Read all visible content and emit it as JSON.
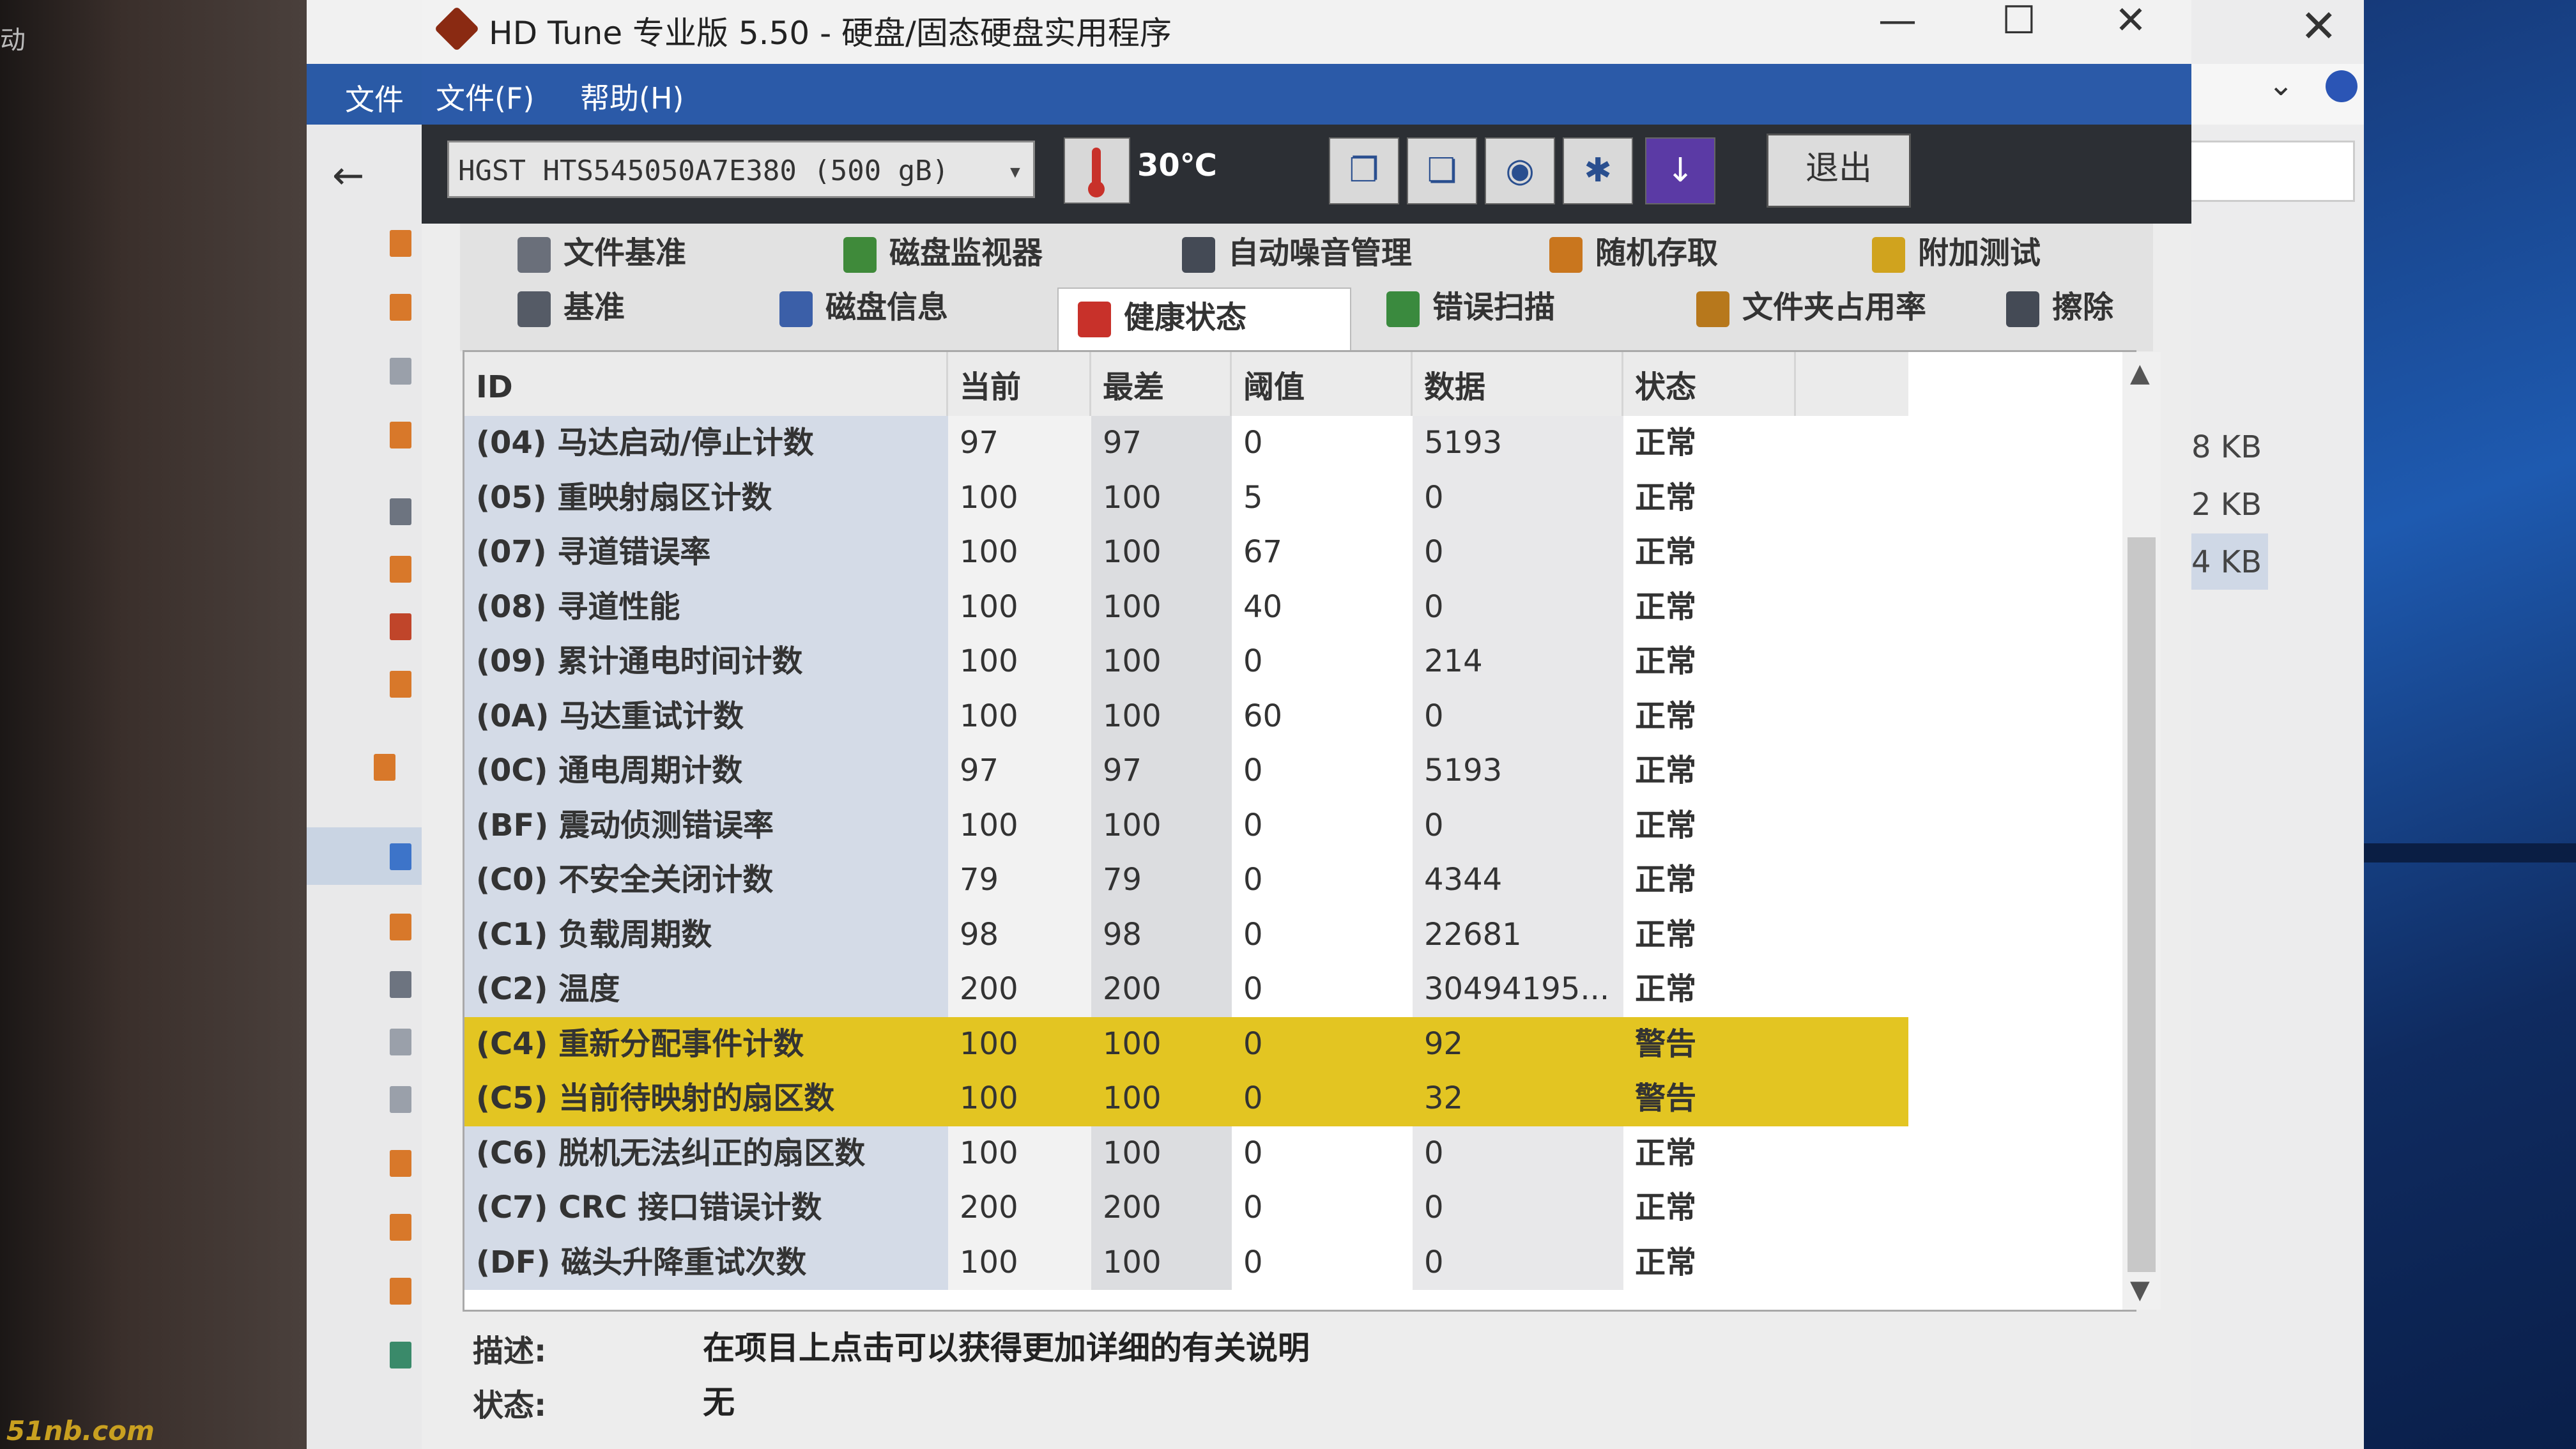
{
  "window": {
    "title": "HD Tune 专业版 5.50 - 硬盘/固态硬盘实用程序",
    "min_label": "—",
    "max_label": "☐",
    "close_label": "✕"
  },
  "background": {
    "left_text": "动",
    "explorer_menu": "文件",
    "explorer_sizes": [
      "8 KB",
      "2 KB",
      "4 KB"
    ],
    "watermark": "51nb.com"
  },
  "menu": {
    "file": "文件(F)",
    "help": "帮助(H)"
  },
  "toolbar": {
    "drive": "HGST HTS545050A7E380 (500 gB)",
    "temperature": "30℃",
    "exit_label": "退出",
    "icons": [
      "copy-info-icon",
      "copy-clipboard-icon",
      "screenshot-icon",
      "options-icon",
      "download-icon"
    ]
  },
  "tabs_row1": [
    {
      "label": "文件基准",
      "icon": "file-benchmark-icon",
      "color": "#6a6f7a"
    },
    {
      "label": "磁盘监视器",
      "icon": "disk-monitor-icon",
      "color": "#3f8a3a"
    },
    {
      "label": "自动噪音管理",
      "icon": "speaker-icon",
      "color": "#444a55"
    },
    {
      "label": "随机存取",
      "icon": "random-access-icon",
      "color": "#c9761e"
    },
    {
      "label": "附加测试",
      "icon": "extra-tests-icon",
      "color": "#d0a31e"
    }
  ],
  "tabs_row2": [
    {
      "label": "基准",
      "icon": "benchmark-icon",
      "color": "#555b66"
    },
    {
      "label": "磁盘信息",
      "icon": "disk-info-icon",
      "color": "#3b5fa8"
    },
    {
      "label": "健康状态",
      "icon": "health-icon",
      "color": "#c8312a"
    },
    {
      "label": "错误扫描",
      "icon": "error-scan-icon",
      "color": "#3a8a3e"
    },
    {
      "label": "文件夹占用率",
      "icon": "folder-usage-icon",
      "color": "#b7781c"
    },
    {
      "label": "擦除",
      "icon": "erase-icon",
      "color": "#444a55"
    }
  ],
  "table": {
    "headers": [
      "ID",
      "当前",
      "最差",
      "阈值",
      "数据",
      "状态"
    ],
    "rows": [
      {
        "id": "(04) 马达启动/停止计数",
        "current": "97",
        "worst": "97",
        "threshold": "0",
        "data": "5193",
        "status": "正常",
        "warn": false
      },
      {
        "id": "(05) 重映射扇区计数",
        "current": "100",
        "worst": "100",
        "threshold": "5",
        "data": "0",
        "status": "正常",
        "warn": false
      },
      {
        "id": "(07) 寻道错误率",
        "current": "100",
        "worst": "100",
        "threshold": "67",
        "data": "0",
        "status": "正常",
        "warn": false
      },
      {
        "id": "(08) 寻道性能",
        "current": "100",
        "worst": "100",
        "threshold": "40",
        "data": "0",
        "status": "正常",
        "warn": false
      },
      {
        "id": "(09) 累计通电时间计数",
        "current": "100",
        "worst": "100",
        "threshold": "0",
        "data": "214",
        "status": "正常",
        "warn": false
      },
      {
        "id": "(0A) 马达重试计数",
        "current": "100",
        "worst": "100",
        "threshold": "60",
        "data": "0",
        "status": "正常",
        "warn": false
      },
      {
        "id": "(0C) 通电周期计数",
        "current": "97",
        "worst": "97",
        "threshold": "0",
        "data": "5193",
        "status": "正常",
        "warn": false
      },
      {
        "id": "(BF) 震动侦测错误率",
        "current": "100",
        "worst": "100",
        "threshold": "0",
        "data": "0",
        "status": "正常",
        "warn": false
      },
      {
        "id": "(C0) 不安全关闭计数",
        "current": "79",
        "worst": "79",
        "threshold": "0",
        "data": "4344",
        "status": "正常",
        "warn": false
      },
      {
        "id": "(C1) 负载周期数",
        "current": "98",
        "worst": "98",
        "threshold": "0",
        "data": "22681",
        "status": "正常",
        "warn": false
      },
      {
        "id": "(C2) 温度",
        "current": "200",
        "worst": "200",
        "threshold": "0",
        "data": "30494195...",
        "status": "正常",
        "warn": false
      },
      {
        "id": "(C4) 重新分配事件计数",
        "current": "100",
        "worst": "100",
        "threshold": "0",
        "data": "92",
        "status": "警告",
        "warn": true
      },
      {
        "id": "(C5) 当前待映射的扇区数",
        "current": "100",
        "worst": "100",
        "threshold": "0",
        "data": "32",
        "status": "警告",
        "warn": true
      },
      {
        "id": "(C6) 脱机无法纠正的扇区数",
        "current": "100",
        "worst": "100",
        "threshold": "0",
        "data": "0",
        "status": "正常",
        "warn": false
      },
      {
        "id": "(C7) CRC 接口错误计数",
        "current": "200",
        "worst": "200",
        "threshold": "0",
        "data": "0",
        "status": "正常",
        "warn": false
      },
      {
        "id": "(DF) 磁头升降重试次数",
        "current": "100",
        "worst": "100",
        "threshold": "0",
        "data": "0",
        "status": "正常",
        "warn": false
      }
    ]
  },
  "description": {
    "label": "描述:",
    "value": "在项目上点击可以获得更加详细的有关说明"
  },
  "status": {
    "label": "状态:",
    "value": "无"
  },
  "colors": {
    "warning_row": "#e3c522",
    "menubar": "#2b5aa8",
    "toolbar": "#2c2f34"
  }
}
